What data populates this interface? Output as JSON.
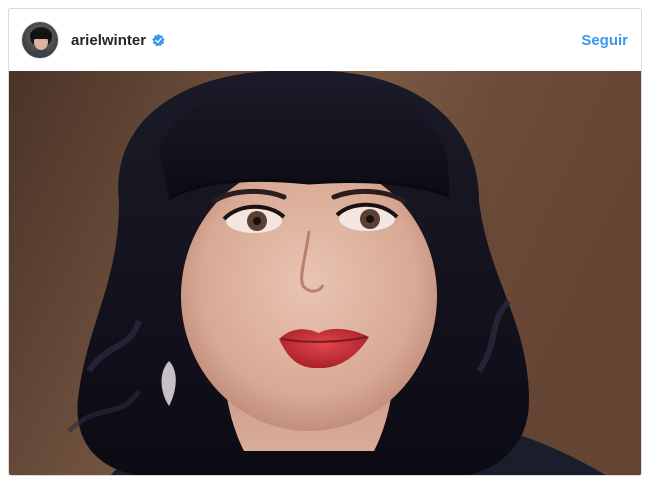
{
  "header": {
    "username": "arielwinter",
    "follow_label": "Seguir",
    "verified": true,
    "verified_icon": "verified-badge-icon"
  },
  "colors": {
    "accent": "#3897f0",
    "border": "#dbdbdb",
    "username": "#262626"
  }
}
